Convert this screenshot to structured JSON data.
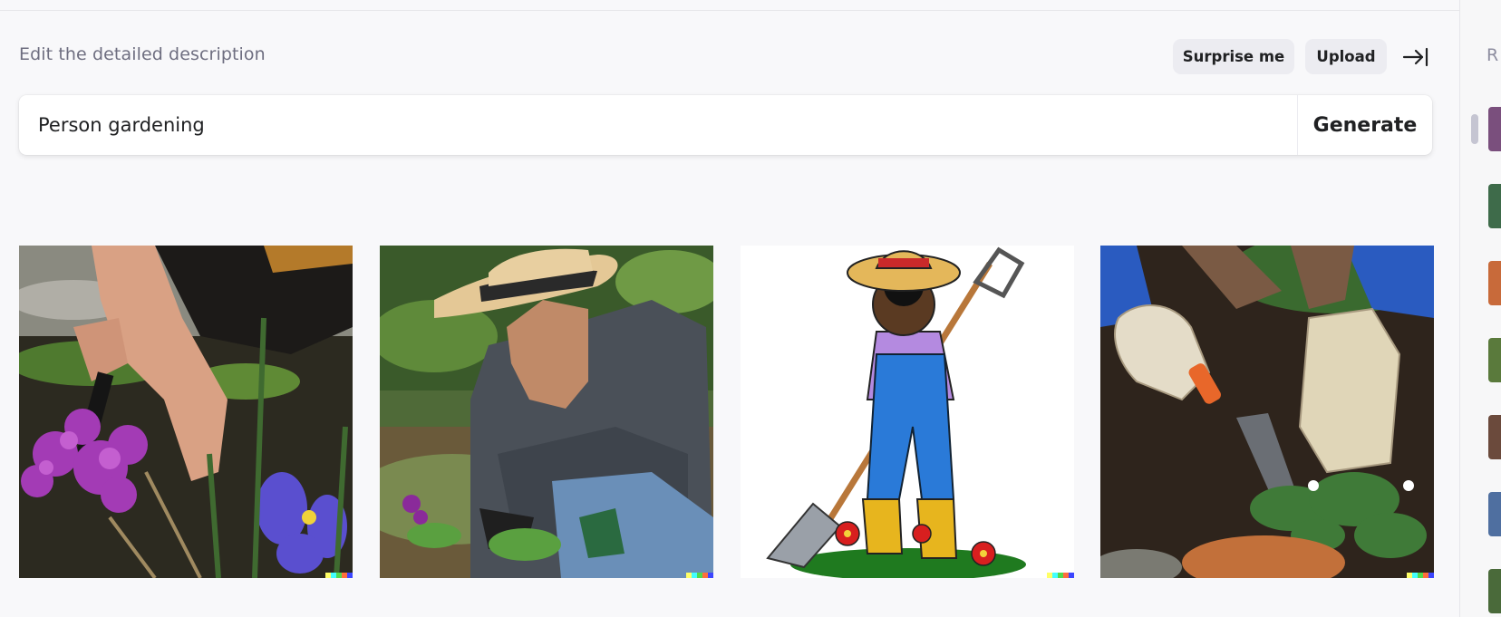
{
  "editor": {
    "label": "Edit the detailed description",
    "surprise_label": "Surprise me",
    "upload_label": "Upload",
    "prompt_value": "Person gardening",
    "generate_label": "Generate"
  },
  "results": [
    {
      "name": "image-1",
      "description": "hands planting purple flowers"
    },
    {
      "name": "image-2",
      "description": "man in straw hat gardening"
    },
    {
      "name": "image-3",
      "description": "cartoon gardener with shovel"
    },
    {
      "name": "image-4",
      "description": "gloved hands with trowel"
    }
  ],
  "history": {
    "title": "R",
    "thumbnail_colors": [
      "#7a4f7d",
      "#3e6b4a",
      "#c86a3a",
      "#5a7a3c",
      "#6b4a3c",
      "#4f6fa0",
      "#4a6a3a"
    ]
  },
  "colors": {
    "accent": "#202123",
    "muted": "#6e6e80",
    "pill_bg": "#ececf1"
  }
}
